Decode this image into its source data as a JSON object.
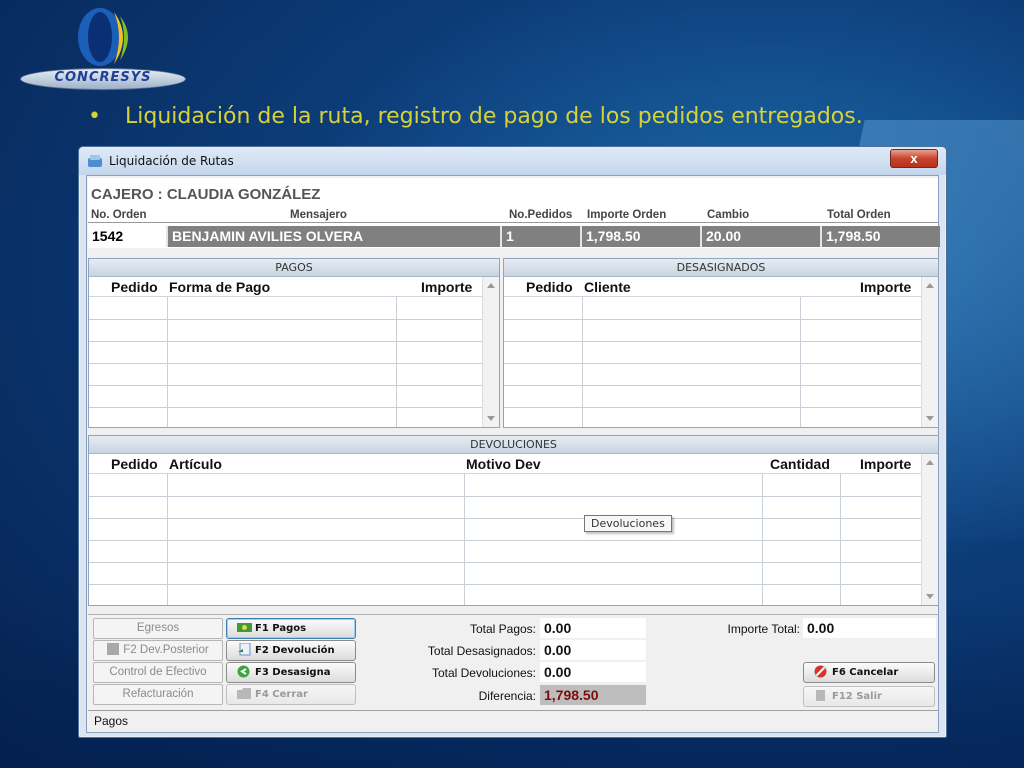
{
  "brand": {
    "name": "CONCRESYS"
  },
  "slide": {
    "bullet": "•",
    "title": "Liquidación de la ruta, registro de pago de los pedidos entregados."
  },
  "window": {
    "title": "Liquidación de Rutas",
    "close_label": "x"
  },
  "header": {
    "cajero": "CAJERO : CLAUDIA GONZÁLEZ",
    "columns": {
      "orden": "No. Orden",
      "mensajero": "Mensajero",
      "pedidos": "No.Pedidos",
      "importe": "Importe Orden",
      "cambio": "Cambio",
      "total": "Total Orden"
    },
    "row": {
      "orden": "1542",
      "mensajero": "BENJAMIN AVILIES OLVERA",
      "pedidos": "1",
      "importe": "1,798.50",
      "cambio": "20.00",
      "total": "1,798.50"
    }
  },
  "pagos": {
    "caption": "PAGOS",
    "columns": {
      "pedido": "Pedido",
      "forma": "Forma de Pago",
      "importe": "Importe"
    }
  },
  "desasignados": {
    "caption": "DESASIGNADOS",
    "columns": {
      "pedido": "Pedido",
      "cliente": "Cliente",
      "importe": "Importe"
    }
  },
  "devoluciones": {
    "caption": "DEVOLUCIONES",
    "columns": {
      "pedido": "Pedido",
      "articulo": "Artículo",
      "motivo": "Motivo Dev",
      "cantidad": "Cantidad",
      "importe": "Importe"
    },
    "tooltip": "Devoluciones"
  },
  "actions": {
    "egresos": "Egresos",
    "dev_posterior": "F2  Dev.Posterior",
    "control_efectivo": "Control de Efectivo",
    "refacturacion": "Refacturación",
    "f1_pagos": "F1  Pagos",
    "f2_devolucion": "F2  Devolución",
    "f3_desasigna": "F3  Desasigna",
    "f4_cerrar": "F4  Cerrar",
    "f6_cancelar": "F6  Cancelar",
    "f12_salir": "F12  Salir"
  },
  "totals": {
    "pagos_label": "Total Pagos:",
    "pagos_value": "0.00",
    "desasignados_label": "Total Desasignados:",
    "desasignados_value": "0.00",
    "devoluciones_label": "Total Devoluciones:",
    "devoluciones_value": "0.00",
    "diferencia_label": "Diferencia:",
    "diferencia_value": "1,798.50",
    "importe_total_label": "Importe Total:",
    "importe_total_value": "0.00"
  },
  "status": {
    "text": "Pagos"
  },
  "colors": {
    "title_yellow": "#d8d23a",
    "diferencia_red": "#7d0d0d"
  }
}
